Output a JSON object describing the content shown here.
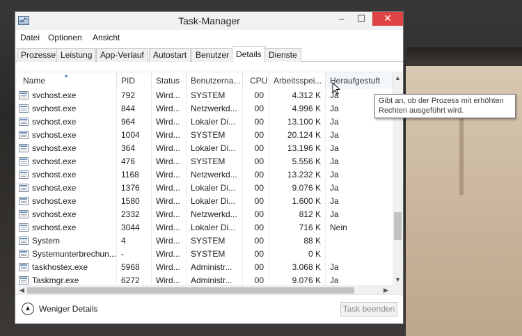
{
  "window": {
    "title": "Task-Manager"
  },
  "titlebar": {
    "minimize_glyph": "–",
    "maximize_glyph": "☐",
    "close_glyph": "✕"
  },
  "menu": [
    "Datei",
    "Optionen",
    "Ansicht"
  ],
  "tabs": [
    {
      "label": "Prozesse",
      "active": false
    },
    {
      "label": "Leistung",
      "active": false
    },
    {
      "label": "App-Verlauf",
      "active": false
    },
    {
      "label": "Autostart",
      "active": false
    },
    {
      "label": "Benutzer",
      "active": false
    },
    {
      "label": "Details",
      "active": true
    },
    {
      "label": "Dienste",
      "active": false
    }
  ],
  "columns": {
    "name": "Name",
    "pid": "PID",
    "status": "Status",
    "user": "Benutzerna...",
    "cpu": "CPU",
    "memory": "Arbeitsspei...",
    "elevated": "Heraufgestuft"
  },
  "rows": [
    {
      "name": "svchost.exe",
      "pid": "792",
      "status": "Wird...",
      "user": "SYSTEM",
      "cpu": "00",
      "memory": "4.312 K",
      "elevated": "Ja"
    },
    {
      "name": "svchost.exe",
      "pid": "844",
      "status": "Wird...",
      "user": "Netzwerkd...",
      "cpu": "00",
      "memory": "4.996 K",
      "elevated": "Ja"
    },
    {
      "name": "svchost.exe",
      "pid": "964",
      "status": "Wird...",
      "user": "Lokaler Di...",
      "cpu": "00",
      "memory": "13.100 K",
      "elevated": "Ja"
    },
    {
      "name": "svchost.exe",
      "pid": "1004",
      "status": "Wird...",
      "user": "SYSTEM",
      "cpu": "00",
      "memory": "20.124 K",
      "elevated": "Ja"
    },
    {
      "name": "svchost.exe",
      "pid": "364",
      "status": "Wird...",
      "user": "Lokaler Di...",
      "cpu": "00",
      "memory": "13.196 K",
      "elevated": "Ja"
    },
    {
      "name": "svchost.exe",
      "pid": "476",
      "status": "Wird...",
      "user": "SYSTEM",
      "cpu": "00",
      "memory": "5.556 K",
      "elevated": "Ja"
    },
    {
      "name": "svchost.exe",
      "pid": "1168",
      "status": "Wird...",
      "user": "Netzwerkd...",
      "cpu": "00",
      "memory": "13.232 K",
      "elevated": "Ja"
    },
    {
      "name": "svchost.exe",
      "pid": "1376",
      "status": "Wird...",
      "user": "Lokaler Di...",
      "cpu": "00",
      "memory": "9.076 K",
      "elevated": "Ja"
    },
    {
      "name": "svchost.exe",
      "pid": "1580",
      "status": "Wird...",
      "user": "Lokaler Di...",
      "cpu": "00",
      "memory": "1.600 K",
      "elevated": "Ja"
    },
    {
      "name": "svchost.exe",
      "pid": "2332",
      "status": "Wird...",
      "user": "Netzwerkd...",
      "cpu": "00",
      "memory": "812 K",
      "elevated": "Ja"
    },
    {
      "name": "svchost.exe",
      "pid": "3044",
      "status": "Wird...",
      "user": "Lokaler Di...",
      "cpu": "00",
      "memory": "716 K",
      "elevated": "Nein"
    },
    {
      "name": "System",
      "pid": "4",
      "status": "Wird...",
      "user": "SYSTEM",
      "cpu": "00",
      "memory": "88 K",
      "elevated": ""
    },
    {
      "name": "Systemunterbrechun...",
      "pid": "-",
      "status": "Wird...",
      "user": "SYSTEM",
      "cpu": "00",
      "memory": "0 K",
      "elevated": ""
    },
    {
      "name": "taskhostex.exe",
      "pid": "5968",
      "status": "Wird...",
      "user": "Administr...",
      "cpu": "00",
      "memory": "3.068 K",
      "elevated": "Ja"
    },
    {
      "name": "Taskmgr.exe",
      "pid": "6272",
      "status": "Wird...",
      "user": "Administr...",
      "cpu": "00",
      "memory": "9.076 K",
      "elevated": "Ja"
    }
  ],
  "footer": {
    "fewer_details": "Weniger Details",
    "end_task": "Task beenden"
  },
  "tooltip": {
    "line1": "Gibt an, ob der Prozess mit erhöhten",
    "line2": "Rechten ausgeführt wird."
  },
  "colors": {
    "close_button": "#e04343",
    "accent": "#5a7fa8"
  }
}
